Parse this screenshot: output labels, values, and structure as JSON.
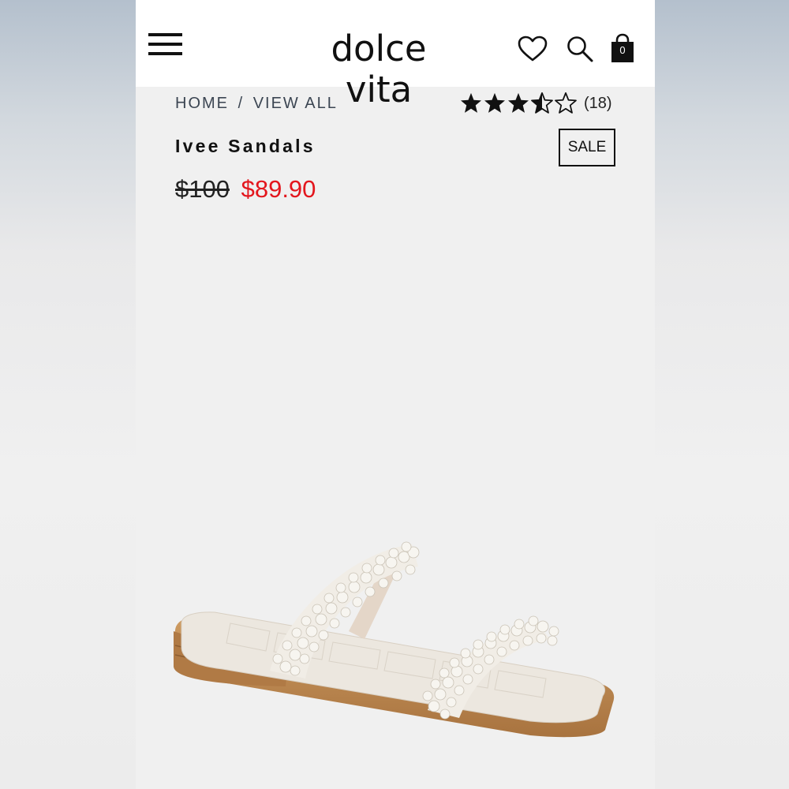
{
  "header": {
    "logo": "dolce vita",
    "cart_count": "0"
  },
  "breadcrumb": {
    "home": "HOME",
    "separator": "/",
    "current": "VIEW ALL"
  },
  "rating": {
    "stars": 3.5,
    "max_stars": 5,
    "review_count": "(18)"
  },
  "product": {
    "title": "Ivee Sandals",
    "badge": "SALE",
    "original_price": "$100",
    "sale_price": "$89.90",
    "image_icon": "pearl-sandal-image"
  },
  "colors": {
    "sale_price": "#e3161d",
    "text": "#111111",
    "breadcrumb": "#3b4552",
    "page_bg": "#f0f0f0",
    "header_bg": "#ffffff"
  }
}
